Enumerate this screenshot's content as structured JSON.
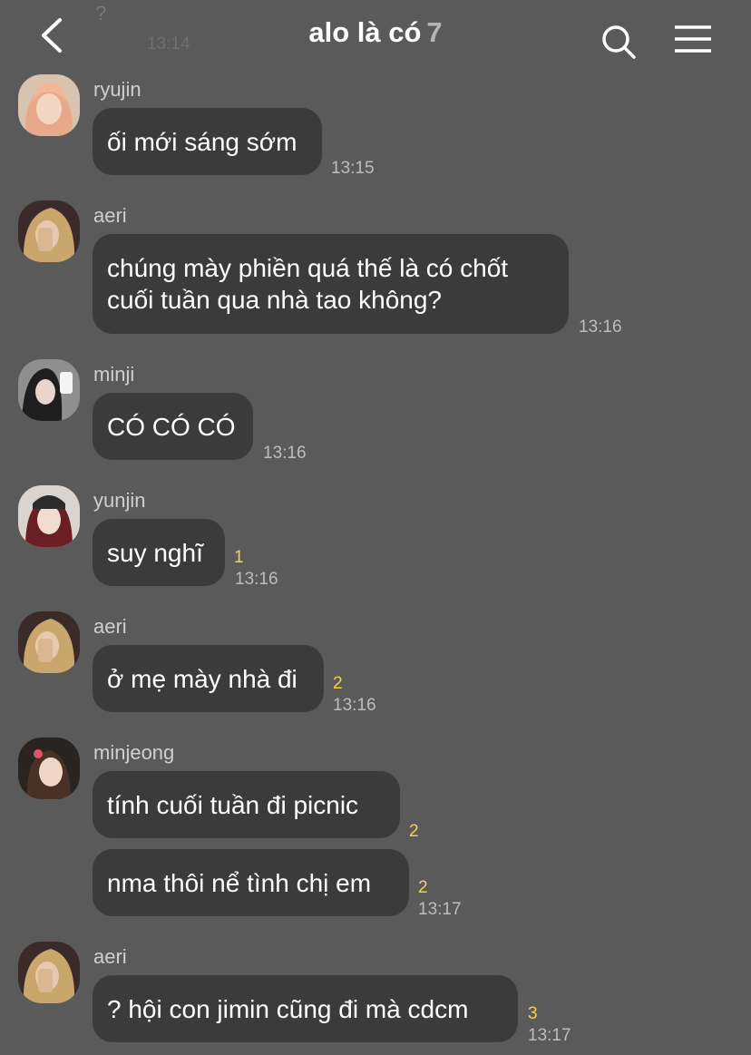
{
  "header": {
    "ghost_text": "?",
    "ghost_time": "13:14",
    "title": "alo là có",
    "member_count": "7"
  },
  "messages": [
    {
      "sender": "ryujin",
      "text": "ối mới sáng sớm",
      "time": "13:15",
      "unread": ""
    },
    {
      "sender": "aeri",
      "text_line1": "chúng mày phiền quá thế là có chốt",
      "text_line2": "cuối tuần qua nhà tao không?",
      "time": "13:16",
      "unread": ""
    },
    {
      "sender": "minji",
      "text": "CÓ CÓ CÓ",
      "time": "13:16",
      "unread": ""
    },
    {
      "sender": "yunjin",
      "text": "suy nghĩ",
      "time": "13:16",
      "unread": "1"
    },
    {
      "sender": "aeri",
      "text": "ở mẹ mày nhà đi",
      "time": "13:16",
      "unread": "2"
    },
    {
      "sender": "minjeong",
      "text": "tính cuối tuần đi picnic",
      "unread": "2",
      "text2": "nma thôi nể tình chị em",
      "unread2": "2",
      "time": "13:17"
    },
    {
      "sender": "aeri",
      "text": "? hội con jimin cũng đi mà cdcm",
      "time": "13:17",
      "unread": "3"
    }
  ],
  "colors": {
    "background": "#5a5a5a",
    "bubble": "#3b3b3b",
    "unread": "#f5d547"
  }
}
